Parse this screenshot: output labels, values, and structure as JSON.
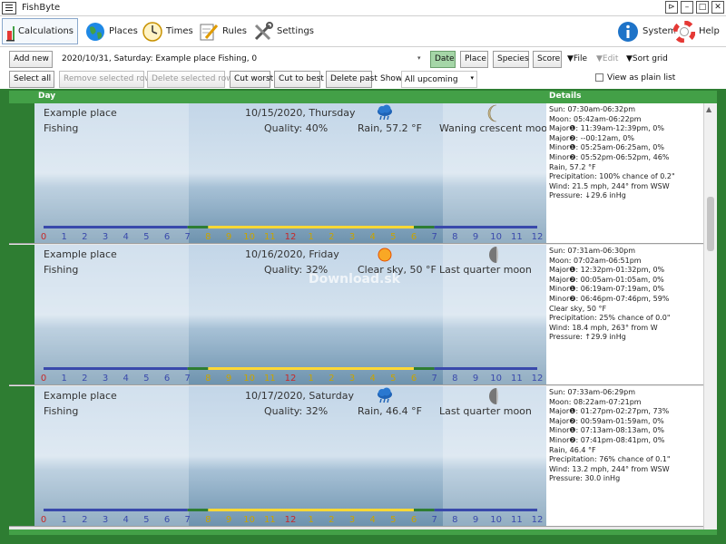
{
  "window": {
    "title": "FishByte",
    "controls": [
      "⊳",
      "–",
      "□",
      "✕"
    ]
  },
  "toolbar": [
    {
      "id": "calculations",
      "label": "Calculations",
      "icon": "bar-chart-icon",
      "active": true
    },
    {
      "id": "places",
      "label": "Places",
      "icon": "globe-icon"
    },
    {
      "id": "times",
      "label": "Times",
      "icon": "clock-icon"
    },
    {
      "id": "rules",
      "label": "Rules",
      "icon": "pencil-note-icon"
    },
    {
      "id": "settings",
      "label": "Settings",
      "icon": "tools-icon"
    },
    {
      "id": "system",
      "label": "System",
      "icon": "info-icon"
    },
    {
      "id": "help",
      "label": "Help",
      "icon": "lifebuoy-icon"
    }
  ],
  "controls": {
    "add_new": "Add new",
    "selected_desc": "2020/10/31, Saturday: Example place Fishing, 0",
    "date": "Date",
    "place": "Place",
    "species": "Species",
    "score": "Score",
    "file": "▼File",
    "edit": "▼Edit",
    "sort_grid": "▼Sort grid",
    "select_all": "Select all",
    "remove_selected": "Remove selected rows",
    "delete_selected": "Delete selected rows",
    "cut_worst": "Cut worst",
    "cut_best": "Cut to best",
    "delete_past": "Delete past",
    "show_label": "Show",
    "show_value": "All upcoming",
    "view_plain": "View as plain list"
  },
  "grid_headers": {
    "day": "Day",
    "details": "Details"
  },
  "days": [
    {
      "place": "Example place",
      "species": "Fishing",
      "date": "10/15/2020, Thursday",
      "quality": "Quality: 40%",
      "weather": "Rain, 57.2 °F",
      "weather_icon": "rain-cloud-icon",
      "moon": "Waning crescent moon",
      "moon_icon": "crescent-moon-icon",
      "details": [
        "Sun: 07:30am-06:32pm",
        "Moon: 05:42am-06:22pm",
        "Major❶: 11:39am-12:39pm, 0%",
        "Major❷: --00:12am, 0%",
        "Minor❶: 05:25am-06:25am, 0%",
        "Minor❷: 05:52pm-06:52pm, 46%",
        "Rain, 57.2 °F",
        "Precipitation: 100% chance of 0.2\"",
        "Wind: 21.5 mph, 244° from WSW",
        "Pressure: ↓29.6 inHg"
      ]
    },
    {
      "place": "Example place",
      "species": "Fishing",
      "date": "10/16/2020, Friday",
      "quality": "Quality: 32%",
      "weather": "Clear sky, 50 °F",
      "weather_icon": "sun-icon",
      "moon": "Last quarter moon",
      "moon_icon": "half-moon-icon",
      "details": [
        "Sun: 07:31am-06:30pm",
        "Moon: 07:02am-06:51pm",
        "Major❶: 12:32pm-01:32pm, 0%",
        "Major❷: 00:05am-01:05am, 0%",
        "Minor❶: 06:19am-07:19am, 0%",
        "Minor❷: 06:46pm-07:46pm, 59%",
        "Clear sky, 50 °F",
        "Precipitation: 25% chance of 0.0\"",
        "Wind: 18.4 mph, 263° from W",
        "Pressure: ↑29.9 inHg"
      ]
    },
    {
      "place": "Example place",
      "species": "Fishing",
      "date": "10/17/2020, Saturday",
      "quality": "Quality: 32%",
      "weather": "Rain, 46.4 °F",
      "weather_icon": "rain-cloud-icon",
      "moon": "Last quarter moon",
      "moon_icon": "half-moon-icon",
      "details": [
        "Sun: 07:33am-06:29pm",
        "Moon: 08:22am-07:21pm",
        "Major❶: 01:27pm-02:27pm, 73%",
        "Major❷: 00:59am-01:59am, 0%",
        "Minor❶: 07:13am-08:13am, 0%",
        "Minor❷: 07:41pm-08:41pm, 0%",
        "Rain, 46.4 °F",
        "Precipitation: 76% chance of 0.1\"",
        "Wind: 13.2 mph, 244° from WSW",
        "Pressure: 30.0 inHg"
      ]
    }
  ],
  "timeline": {
    "labels": [
      "0",
      "1",
      "2",
      "3",
      "4",
      "5",
      "6",
      "7",
      "8",
      "9",
      "10",
      "11",
      "12",
      "1",
      "2",
      "3",
      "4",
      "5",
      "6",
      "7",
      "8",
      "9",
      "10",
      "11",
      "12"
    ],
    "label_colors": [
      "#c62828",
      "#3949ab",
      "#3949ab",
      "#3949ab",
      "#3949ab",
      "#3949ab",
      "#3949ab",
      "#3949ab",
      "#c9a400",
      "#c9a400",
      "#c9a400",
      "#c9a400",
      "#c62828",
      "#c9a400",
      "#c9a400",
      "#c9a400",
      "#c9a400",
      "#c9a400",
      "#c9a400",
      "#3949ab",
      "#3949ab",
      "#3949ab",
      "#3949ab",
      "#3949ab",
      "#3949ab"
    ]
  },
  "watermark": "Download.sk"
}
